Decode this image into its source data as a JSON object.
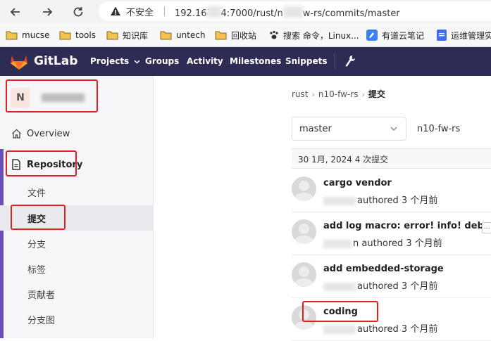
{
  "browser": {
    "security_warning": "不安全",
    "url_prefix": "192.16",
    "url_middle": "4:7000/rust/n",
    "url_suffix": "w-rs/commits/master",
    "bookmarks": [
      {
        "label": "mucse",
        "icon": "folder-icon"
      },
      {
        "label": "tools",
        "icon": "folder-icon"
      },
      {
        "label": "知识库",
        "icon": "folder-icon"
      },
      {
        "label": "untech",
        "icon": "folder-icon"
      },
      {
        "label": "回收站",
        "icon": "folder-icon"
      },
      {
        "label": "搜索 命令，Linux...",
        "icon": "paw-icon"
      },
      {
        "label": "有道云笔记",
        "icon": "youdao-icon"
      },
      {
        "label": "运维管理实",
        "icon": "doc-icon"
      }
    ]
  },
  "gitlab_nav": {
    "brand": "GitLab",
    "links": [
      "Projects",
      "Groups",
      "Activity",
      "Milestones",
      "Snippets"
    ]
  },
  "sidebar": {
    "project_initial": "N",
    "overview": "Overview",
    "repository": "Repository",
    "sub_items": [
      "文件",
      "提交",
      "分支",
      "标签",
      "贡献者",
      "分支图"
    ]
  },
  "breadcrumb": {
    "group": "rust",
    "project": "n10-fw-rs",
    "current": "提交"
  },
  "branch": {
    "selected": "master",
    "path": "n10-fw-rs"
  },
  "day_header": "30 1月, 2024 4 次提交",
  "commits": [
    {
      "title": "cargo vendor",
      "author_suffix": "",
      "meta": "authored 3 个月前"
    },
    {
      "title": "add log macro: error! info! debug!",
      "author_suffix": "n",
      "meta": "authored 3 个月前"
    },
    {
      "title": "add embedded-storage",
      "author_suffix": "",
      "meta": "authored 3 个月前"
    },
    {
      "title": "coding",
      "author_suffix": "",
      "meta": "authored 3 个月前"
    }
  ],
  "colors": {
    "nav_bg": "#2e2c54",
    "accent": "#6b4fbb",
    "annotation": "#e02020"
  }
}
